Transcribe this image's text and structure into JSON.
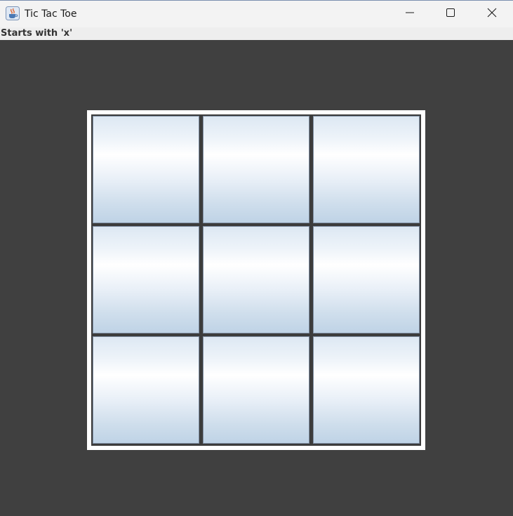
{
  "window": {
    "title": "Tic Tac Toe",
    "icon": "java-cup-icon",
    "controls": [
      "minimize-icon",
      "maximize-icon",
      "close-icon"
    ]
  },
  "status": {
    "text": "Starts with 'x'"
  },
  "board": {
    "rows": 3,
    "cols": 3,
    "cells": [
      "",
      "",
      "",
      "",
      "",
      "",
      "",
      "",
      ""
    ]
  },
  "colors": {
    "background": "#404040",
    "board_border": "#ffffff",
    "grid_lines": "#3c3c3c",
    "cell_top": "#dde8f3",
    "cell_mid": "#ffffff",
    "cell_bottom": "#bfd3e6"
  }
}
